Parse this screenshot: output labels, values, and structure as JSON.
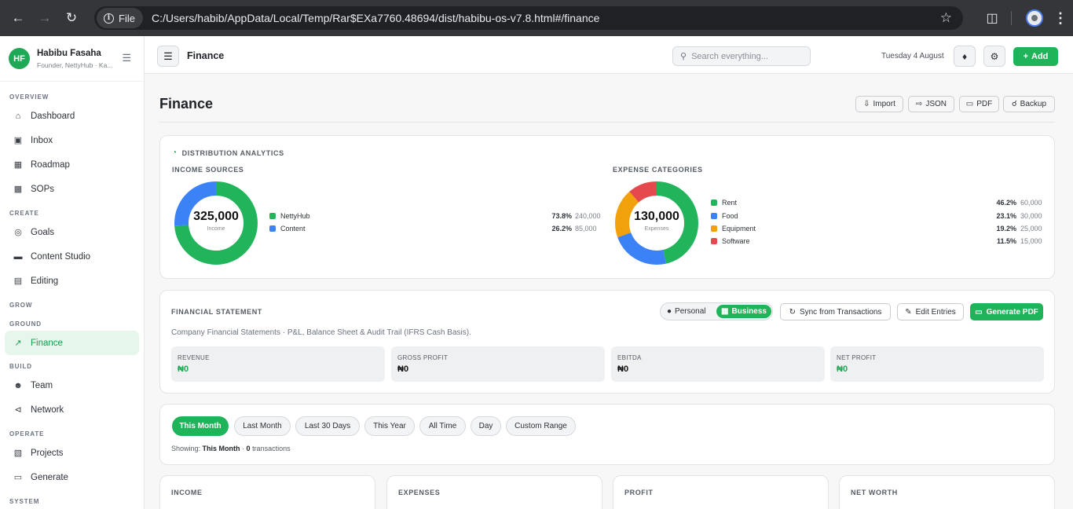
{
  "browser": {
    "file_chip": "File",
    "url": "C:/Users/habib/AppData/Local/Temp/Rar$EXa7760.48694/dist/habibu-os-v7.8.html#/finance"
  },
  "sidebar": {
    "avatar_initials": "HF",
    "user_name": "Habibu Fasaha",
    "user_role": "Founder, NettyHub · Ka...",
    "sections": {
      "overview": "OVERVIEW",
      "create": "CREATE",
      "grow": "GROW",
      "ground": "GROUND",
      "build": "BUILD",
      "operate": "OPERATE",
      "system": "SYSTEM"
    },
    "items": {
      "dashboard": "Dashboard",
      "inbox": "Inbox",
      "roadmap": "Roadmap",
      "sops": "SOPs",
      "goals": "Goals",
      "content_studio": "Content Studio",
      "editing": "Editing",
      "finance": "Finance",
      "team": "Team",
      "network": "Network",
      "projects": "Projects",
      "generate": "Generate"
    }
  },
  "topbar": {
    "title": "Finance",
    "search_placeholder": "Search everything...",
    "date": "Tuesday 4 August",
    "add_label": "Add"
  },
  "page": {
    "title": "Finance",
    "actions": {
      "import": "Import",
      "json": "JSON",
      "pdf": "PDF",
      "backup": "Backup"
    }
  },
  "distribution": {
    "heading": "DISTRIBUTION ANALYTICS",
    "income": {
      "label": "INCOME SOURCES",
      "total": "325,000",
      "sub": "Income",
      "slices": [
        {
          "name": "NettyHub",
          "pct": "73.8%",
          "value": "240,000",
          "share": 0.738,
          "color": "#22b45a"
        },
        {
          "name": "Content",
          "pct": "26.2%",
          "value": "85,000",
          "share": 0.262,
          "color": "#3b82f6"
        }
      ]
    },
    "expense": {
      "label": "EXPENSE CATEGORIES",
      "total": "130,000",
      "sub": "Expenses",
      "slices": [
        {
          "name": "Rent",
          "pct": "46.2%",
          "value": "60,000",
          "share": 0.462,
          "color": "#22b45a"
        },
        {
          "name": "Food",
          "pct": "23.1%",
          "value": "30,000",
          "share": 0.231,
          "color": "#3b82f6"
        },
        {
          "name": "Equipment",
          "pct": "19.2%",
          "value": "25,000",
          "share": 0.192,
          "color": "#f0a10c"
        },
        {
          "name": "Software",
          "pct": "11.5%",
          "value": "15,000",
          "share": 0.115,
          "color": "#e5484d"
        }
      ]
    }
  },
  "statement": {
    "heading": "FINANCIAL STATEMENT",
    "toggle_personal": "Personal",
    "toggle_business": "Business",
    "sync": "Sync from Transactions",
    "edit": "Edit Entries",
    "generate": "Generate PDF",
    "description": "Company Financial Statements · P&L, Balance Sheet & Audit Trail (IFRS Cash Basis).",
    "kpis": [
      {
        "label": "REVENUE",
        "value": "₦0"
      },
      {
        "label": "GROSS PROFIT",
        "value": "₦0"
      },
      {
        "label": "EBITDA",
        "value": "₦0"
      },
      {
        "label": "NET PROFIT",
        "value": "₦0"
      }
    ]
  },
  "filters": {
    "pills": [
      "This Month",
      "Last Month",
      "Last 30 Days",
      "This Year",
      "All Time",
      "Day",
      "Custom Range"
    ],
    "showing_prefix": "Showing:",
    "showing_period": "This Month",
    "showing_sep": " · ",
    "showing_count": "0",
    "showing_suffix": " transactions"
  },
  "bottom_cards": [
    "INCOME",
    "EXPENSES",
    "PROFIT",
    "NET WORTH"
  ],
  "colors": {
    "accent": "#1fb35a",
    "active_nav_bg": "#e6f6ec"
  }
}
